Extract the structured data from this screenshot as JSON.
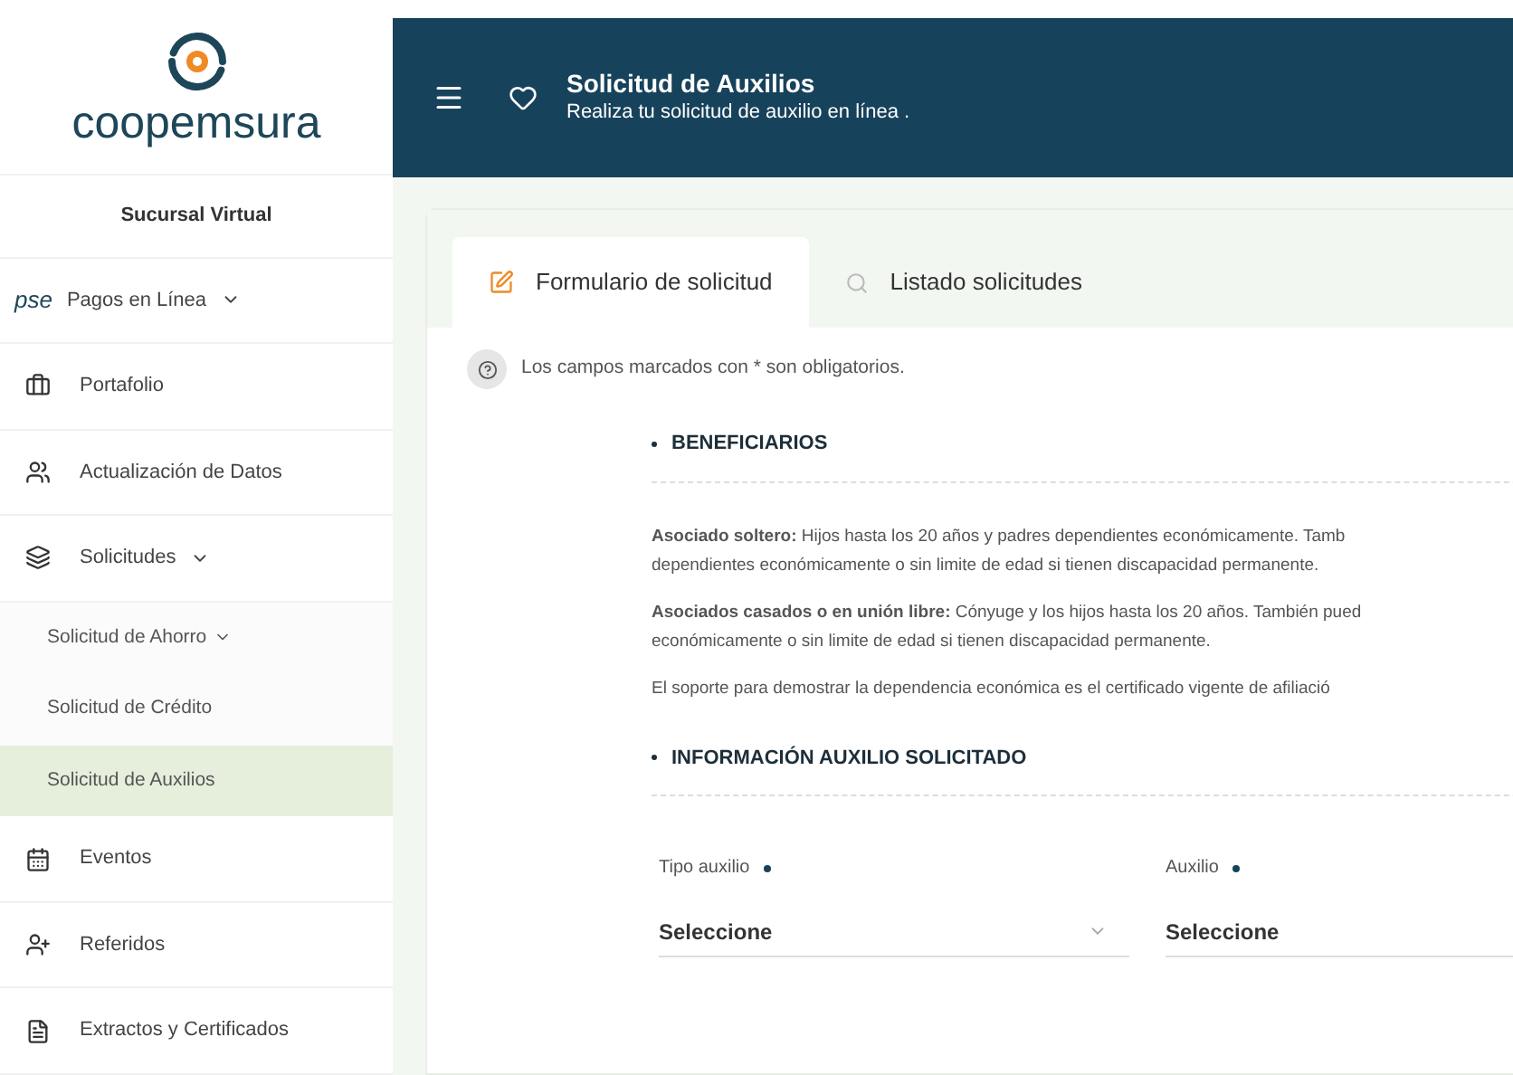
{
  "brand": {
    "name": "coopemsura",
    "subtitle": "Sucursal Virtual"
  },
  "sidebar": {
    "items": [
      {
        "kind": "pse",
        "badge": "pse",
        "label": "Pagos en Línea",
        "expandable": true
      },
      {
        "kind": "portfolio",
        "label": "Portafolio",
        "expandable": false
      },
      {
        "kind": "users",
        "label": "Actualización de Datos",
        "expandable": false
      },
      {
        "kind": "layers",
        "label": "Solicitudes",
        "expandable": true,
        "children": [
          {
            "label": "Solicitud de Ahorro",
            "expandable": true,
            "selected": false
          },
          {
            "label": "Solicitud de Crédito",
            "expandable": false,
            "selected": false
          },
          {
            "label": "Solicitud de Auxilios",
            "expandable": false,
            "selected": true
          }
        ]
      },
      {
        "kind": "calendar",
        "label": "Eventos",
        "expandable": false
      },
      {
        "kind": "user-plus",
        "label": "Referidos",
        "expandable": false
      },
      {
        "kind": "file",
        "label": "Extractos y Certificados",
        "expandable": false
      }
    ]
  },
  "header": {
    "title": "Solicitud de Auxilios",
    "subtitle": "Realiza tu solicitud de auxilio en línea ."
  },
  "tabs": [
    {
      "kind": "edit",
      "label": "Formulario de solicitud",
      "selected": true
    },
    {
      "kind": "search",
      "label": "Listado solicitudes",
      "selected": false
    }
  ],
  "notice": "Los campos marcados con * son obligatorios.",
  "sections": [
    {
      "title": "BENEFICIARIOS",
      "paragraphs": [
        [
          "**Asociado soltero:** Hijos hasta los 20 años y padres dependientes económicamente. Tamb",
          "dependientes económicamente o sin limite de edad si tienen discapacidad permanente."
        ],
        [
          "**Asociados casados o en unión libre:** Cónyuge y los hijos hasta los 20 años. También pued",
          "económicamente o sin limite de edad si tienen discapacidad permanente."
        ],
        [
          "El soporte para demostrar la dependencia económica es el certificado vigente de afiliació"
        ]
      ]
    },
    {
      "title": "INFORMACIÓN AUXILIO SOLICITADO",
      "fields": [
        {
          "label": "Tipo auxilio",
          "required": true,
          "value": "Seleccione"
        },
        {
          "label": "Auxilio",
          "required": true,
          "value": "Seleccione"
        }
      ]
    }
  ]
}
